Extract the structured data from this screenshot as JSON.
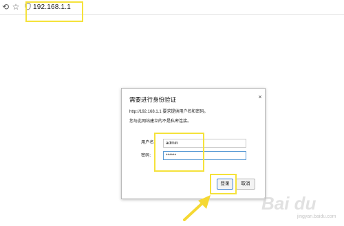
{
  "browser": {
    "address": "192.168.1.1",
    "back_icon": "undo-icon",
    "star_icon": "star-icon",
    "security_icon": "shield-icon"
  },
  "dialog": {
    "title": "需要进行身份验证",
    "close": "×",
    "message_line1": "http://192.168.1.1  要求提供用户名和密码。",
    "message_line2": "您与此网站建立的不是私密连接。",
    "username_label": "用户名:",
    "username_value": "admin",
    "password_label": "密码:",
    "password_value": "******",
    "login_button": "登录",
    "cancel_button": "取消"
  },
  "watermark": {
    "text": "Bai du",
    "sub": "jingyan.baidu.com"
  },
  "colors": {
    "highlight": "#f5e23a",
    "focus_border": "#5b9bd5"
  }
}
